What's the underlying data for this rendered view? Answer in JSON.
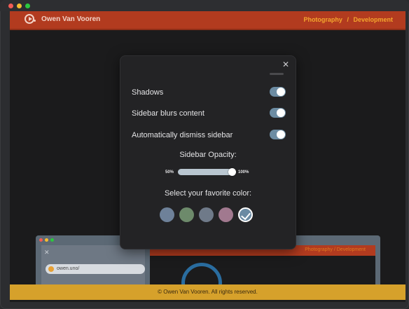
{
  "site": {
    "name": "Owen Van Vooren",
    "nav": [
      "Photography",
      "/",
      "Development"
    ],
    "footer": "© Owen Van Vooren. All rights reserved."
  },
  "preview": {
    "url": "owen.uno/",
    "nav": "Photography   /   Development"
  },
  "modal": {
    "close_icon": "close-icon",
    "toggles": [
      {
        "label": "Shadows",
        "on": true
      },
      {
        "label": "Sidebar blurs content",
        "on": true
      },
      {
        "label": "Automatically dismiss sidebar",
        "on": true
      }
    ],
    "opacity": {
      "title": "Sidebar Opacity:",
      "min_label": "50%",
      "max_label": "100%",
      "value": 0.95
    },
    "color_title": "Select your favorite color:",
    "colors": [
      {
        "name": "slate-blue",
        "hex": "#6e8199",
        "selected": false
      },
      {
        "name": "sage-green",
        "hex": "#6d8a6b",
        "selected": false
      },
      {
        "name": "gray",
        "hex": "#6f7a89",
        "selected": false
      },
      {
        "name": "mauve",
        "hex": "#a1798f",
        "selected": false
      },
      {
        "name": "steel-blue",
        "hex": "#6b8aa3",
        "selected": true
      }
    ]
  },
  "colors": {
    "header_bg": "#b23b1f",
    "nav_accent": "#f3a62e",
    "footer_bg": "#d6a12b",
    "toggle_on": "#6c8ca3"
  }
}
